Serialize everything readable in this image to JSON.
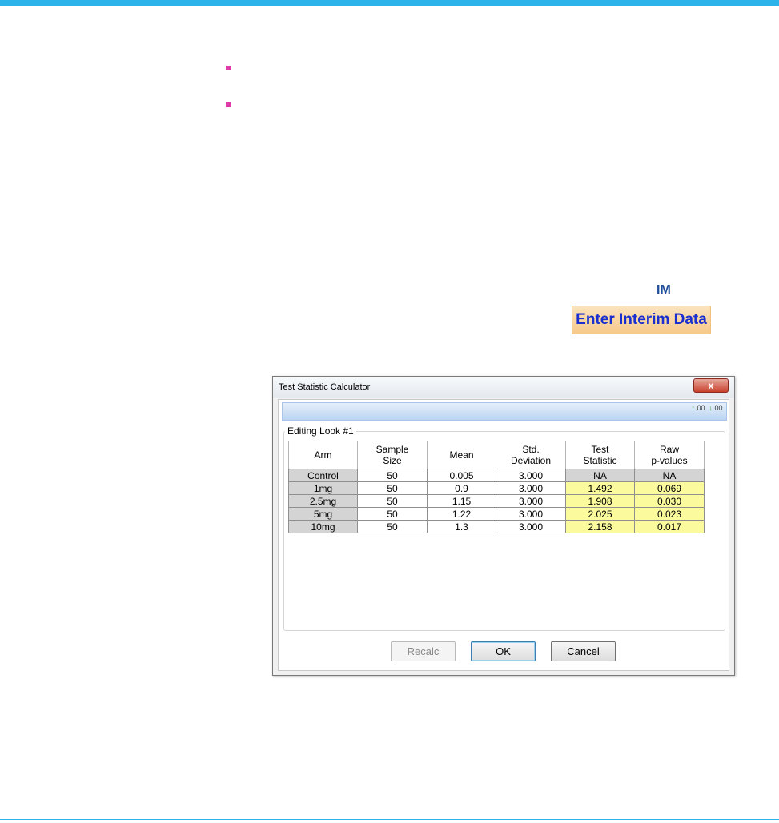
{
  "header": {
    "label": "IM"
  },
  "interim_button": {
    "label": "Enter Interim Data"
  },
  "dialog": {
    "title": "Test Statistic Calculator",
    "close_label": "x",
    "toolbar": {
      "icon1": "increase-decimal-icon",
      "icon2": "decrease-decimal-icon",
      "icon_text": ".00"
    },
    "group_label": "Editing Look #1",
    "columns": [
      [
        "Arm",
        ""
      ],
      [
        "Sample",
        "Size"
      ],
      [
        "Mean",
        ""
      ],
      [
        "Std.",
        "Deviation"
      ],
      [
        "Test",
        "Statistic"
      ],
      [
        "Raw",
        "p-values"
      ]
    ],
    "rows": [
      [
        "Control",
        "50",
        "0.005",
        "3.000",
        "NA",
        "NA"
      ],
      [
        "1mg",
        "50",
        "0.9",
        "3.000",
        "1.492",
        "0.069"
      ],
      [
        "2.5mg",
        "50",
        "1.15",
        "3.000",
        "1.908",
        "0.030"
      ],
      [
        "5mg",
        "50",
        "1.22",
        "3.000",
        "2.025",
        "0.023"
      ],
      [
        "10mg",
        "50",
        "1.3",
        "3.000",
        "2.158",
        "0.017"
      ]
    ],
    "buttons": {
      "recalc": "Recalc",
      "ok": "OK",
      "cancel": "Cancel"
    }
  },
  "colors": {
    "top_bar": "#2bb3ea",
    "bullet": "#e03aa8",
    "interim_button_bg": "#f7c98a",
    "interim_button_text": "#1a2fd0",
    "calc_cell_bg": "#fbfb9e",
    "arm_cell_bg": "#d4d4d4"
  }
}
